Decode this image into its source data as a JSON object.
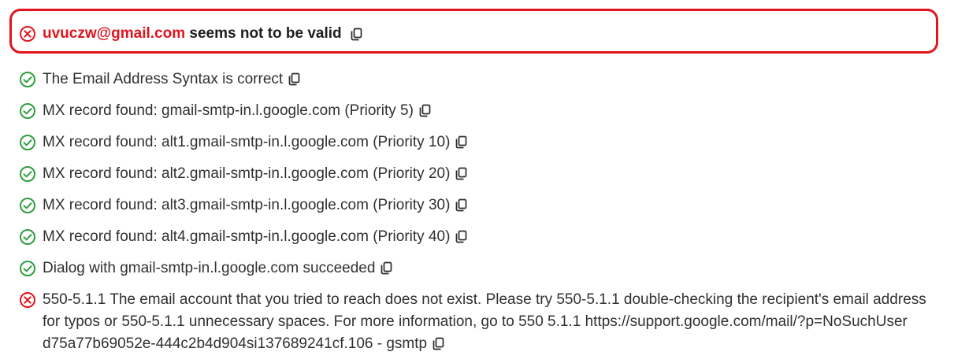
{
  "result": {
    "email": "uvuczw@gmail.com",
    "verdict": " seems not to be valid",
    "status": "invalid",
    "status_icon": "x-circle-icon"
  },
  "colors": {
    "error": "#e1141e",
    "success": "#2e9e3e",
    "text": "#303030"
  },
  "checks": [
    {
      "status": "ok",
      "icon": "check-circle-icon",
      "text": "The Email Address Syntax is correct"
    },
    {
      "status": "ok",
      "icon": "check-circle-icon",
      "text": "MX record found: gmail-smtp-in.l.google.com (Priority 5)"
    },
    {
      "status": "ok",
      "icon": "check-circle-icon",
      "text": "MX record found: alt1.gmail-smtp-in.l.google.com (Priority 10)"
    },
    {
      "status": "ok",
      "icon": "check-circle-icon",
      "text": "MX record found: alt2.gmail-smtp-in.l.google.com (Priority 20)"
    },
    {
      "status": "ok",
      "icon": "check-circle-icon",
      "text": "MX record found: alt3.gmail-smtp-in.l.google.com (Priority 30)"
    },
    {
      "status": "ok",
      "icon": "check-circle-icon",
      "text": "MX record found: alt4.gmail-smtp-in.l.google.com (Priority 40)"
    },
    {
      "status": "ok",
      "icon": "check-circle-icon",
      "text": "Dialog with gmail-smtp-in.l.google.com succeeded"
    },
    {
      "status": "error",
      "icon": "x-circle-icon",
      "text": "550-5.1.1 The email account that you tried to reach does not exist. Please try 550-5.1.1 double-checking the recipient's email address for typos or 550-5.1.1 unnecessary spaces. For more information, go to 550 5.1.1 https://support.google.com/mail/?p=NoSuchUser d75a77b69052e-444c2b4d904si137689241cf.106 - gsmtp"
    }
  ],
  "copy_icon": "copy-icon"
}
